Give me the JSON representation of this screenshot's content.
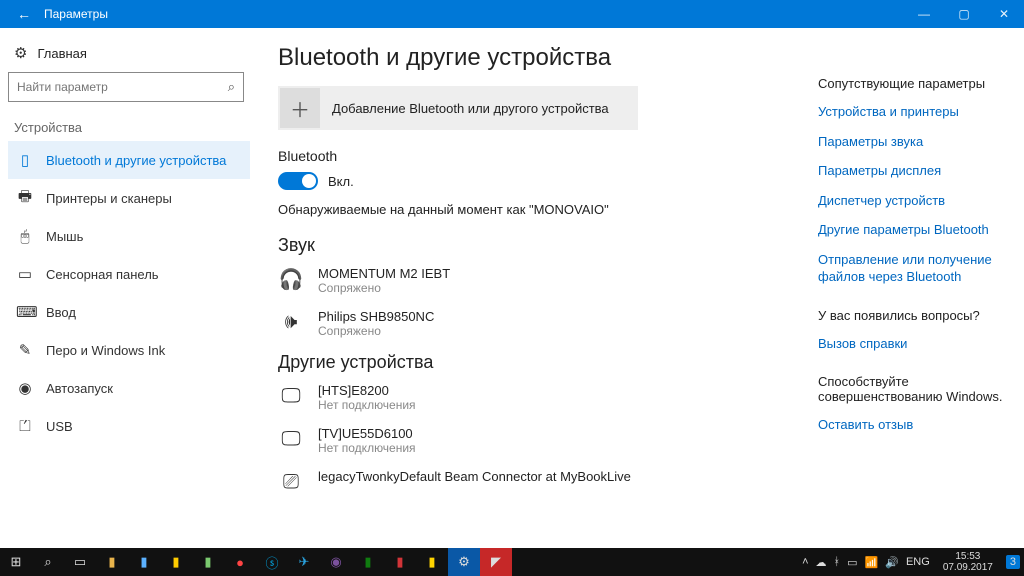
{
  "titlebar": {
    "title": "Параметры"
  },
  "sidebar": {
    "home": "Главная",
    "search_placeholder": "Найти параметр",
    "category": "Устройства",
    "items": [
      {
        "label": "Bluetooth и другие устройства"
      },
      {
        "label": "Принтеры и сканеры"
      },
      {
        "label": "Мышь"
      },
      {
        "label": "Сенсорная панель"
      },
      {
        "label": "Ввод"
      },
      {
        "label": "Перо и Windows Ink"
      },
      {
        "label": "Автозапуск"
      },
      {
        "label": "USB"
      }
    ]
  },
  "main": {
    "heading": "Bluetooth и другие устройства",
    "add_label": "Добавление Bluetooth или другого устройства",
    "bt_section": "Bluetooth",
    "toggle_label": "Вкл.",
    "discoverable": "Обнаруживаемые на данный момент как \"MONOVAIO\"",
    "audio_section": "Звук",
    "audio": [
      {
        "name": "MOMENTUM M2 IEBT",
        "status": "Сопряжено"
      },
      {
        "name": "Philips SHB9850NC",
        "status": "Сопряжено"
      }
    ],
    "other_section": "Другие устройства",
    "other": [
      {
        "name": "[HTS]E8200",
        "status": "Нет подключения"
      },
      {
        "name": "[TV]UE55D6100",
        "status": "Нет подключения"
      },
      {
        "name": "legacyTwonkyDefault Beam Connector at MyBookLive",
        "status": ""
      }
    ]
  },
  "right": {
    "related_head": "Сопутствующие параметры",
    "links": [
      "Устройства и принтеры",
      "Параметры звука",
      "Параметры дисплея",
      "Диспетчер устройств",
      "Другие параметры Bluetooth",
      "Отправление или получение файлов через Bluetooth"
    ],
    "help_head": "У вас появились вопросы?",
    "help_link": "Вызов справки",
    "improve_head": "Способствуйте совершенствованию Windows.",
    "improve_link": "Оставить отзыв"
  },
  "taskbar": {
    "pinned_count": 20,
    "lang": "ENG",
    "time": "15:53",
    "date": "07.09.2017",
    "notif": "3"
  }
}
